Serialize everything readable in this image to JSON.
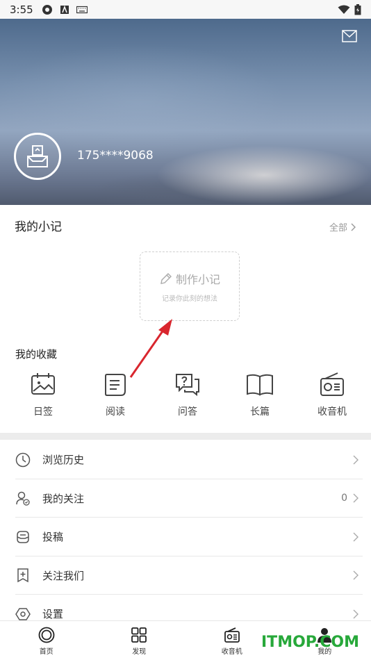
{
  "status_bar": {
    "time": "3:55",
    "icons": [
      "settings-icon",
      "a-icon",
      "keyboard-icon"
    ],
    "right_icons": [
      "wifi-icon",
      "battery-icon"
    ]
  },
  "header": {
    "phone": "175****9068",
    "mail_icon": "mail-icon",
    "avatar_icon": "ballot-box-icon"
  },
  "notes": {
    "title": "我的小记",
    "all_label": "全部",
    "make_label": "制作小记",
    "make_sub": "记录你此刻的想法"
  },
  "favorites": {
    "title": "我的收藏",
    "items": [
      {
        "label": "日签",
        "icon": "calendar-photo-icon"
      },
      {
        "label": "阅读",
        "icon": "document-icon"
      },
      {
        "label": "问答",
        "icon": "qa-icon"
      },
      {
        "label": "长篇",
        "icon": "book-icon"
      },
      {
        "label": "收音机",
        "icon": "radio-icon"
      }
    ]
  },
  "menu": [
    {
      "label": "浏览历史",
      "icon": "clock-icon",
      "count": ""
    },
    {
      "label": "我的关注",
      "icon": "user-follow-icon",
      "count": "0"
    },
    {
      "label": "投稿",
      "icon": "submit-icon",
      "count": ""
    },
    {
      "label": "关注我们",
      "icon": "bookmark-plus-icon",
      "count": ""
    },
    {
      "label": "设置",
      "icon": "settings-hexagon-icon",
      "count": ""
    }
  ],
  "bottom_nav": [
    {
      "label": "首页",
      "icon": "home-circle-icon"
    },
    {
      "label": "发现",
      "icon": "grid-icon"
    },
    {
      "label": "收音机",
      "icon": "radio-icon"
    },
    {
      "label": "我的",
      "icon": "person-icon"
    }
  ],
  "watermark": "ITMOP.COM",
  "colors": {
    "accent_arrow": "#d9262e",
    "watermark": "#27a83a"
  }
}
